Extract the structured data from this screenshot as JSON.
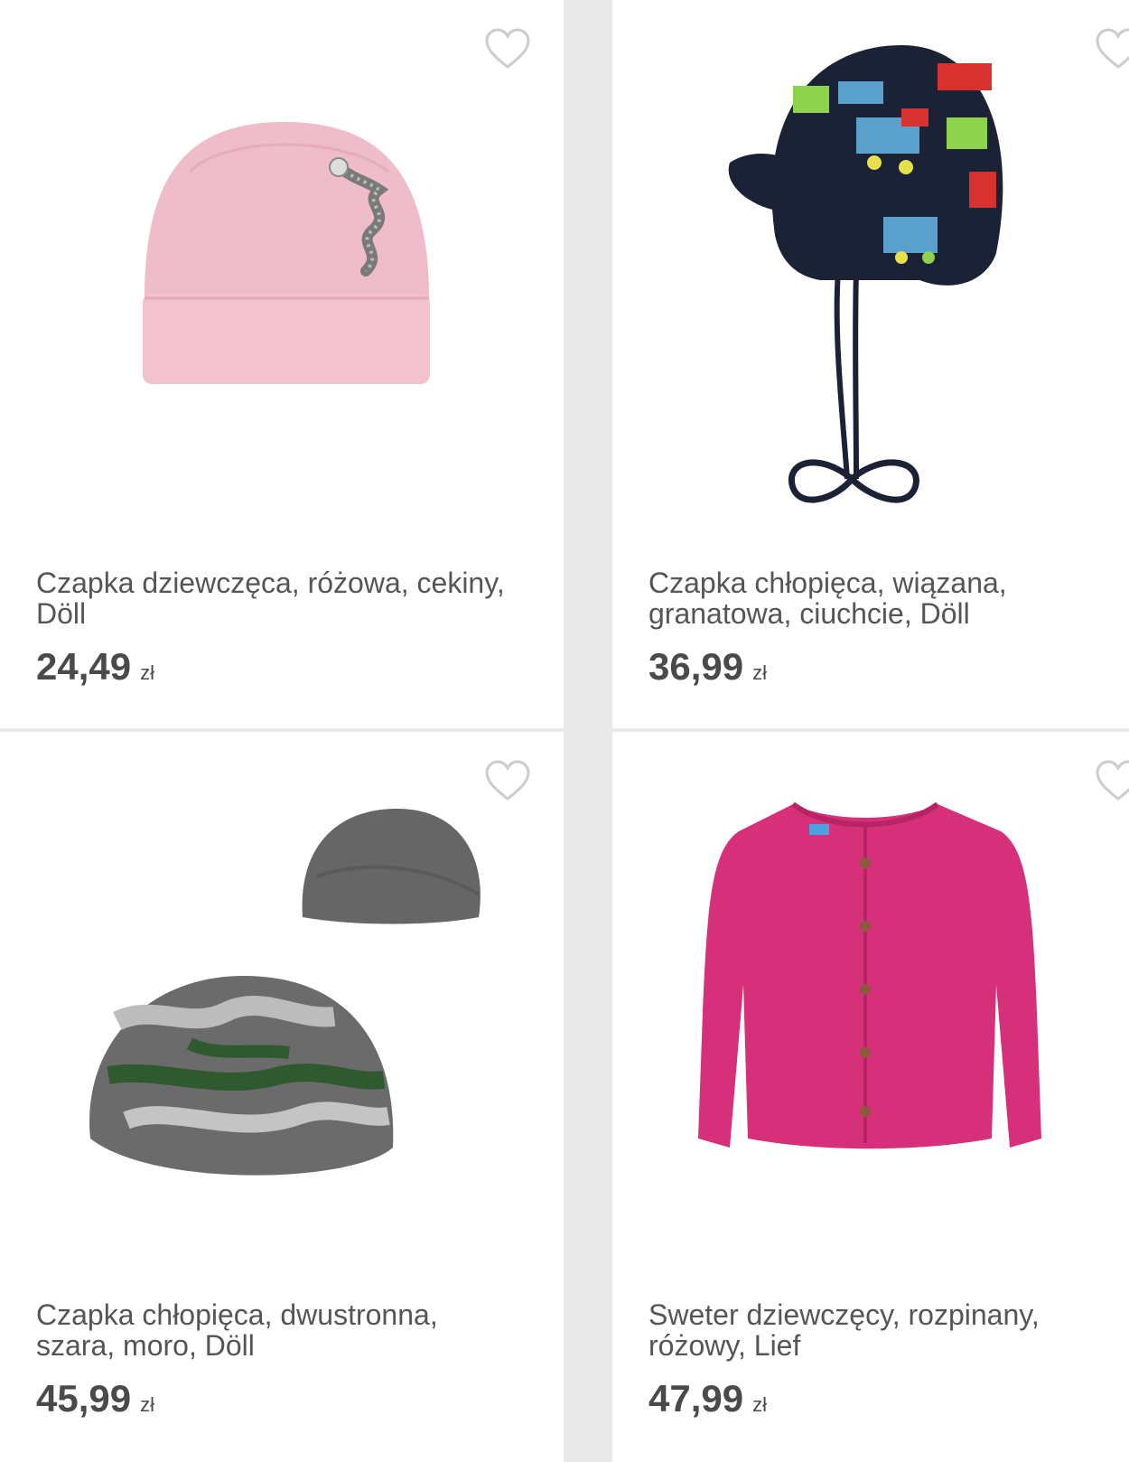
{
  "products": [
    {
      "name": "Czapka dziewczęca, różowa, cekiny, Döll",
      "price": "24,49",
      "currency": "zł",
      "icon": "heart-outline-icon"
    },
    {
      "name": "Czapka chłopięca, wiązana, granatowa, ciuchcie, Döll",
      "price": "36,99",
      "currency": "zł",
      "icon": "heart-outline-icon"
    },
    {
      "name": "Czapka chłopięca, dwustronna, szara, moro, Döll",
      "price": "45,99",
      "currency": "zł",
      "icon": "heart-outline-icon"
    },
    {
      "name": "Sweter dziewczęcy, rozpinany, różowy, Lief",
      "price": "47,99",
      "currency": "zł",
      "icon": "heart-outline-icon"
    }
  ],
  "colors": {
    "background": "#e9e9e9",
    "card": "#ffffff",
    "text": "#555555",
    "price": "#4a4a4a",
    "heart": "#cccccc"
  }
}
